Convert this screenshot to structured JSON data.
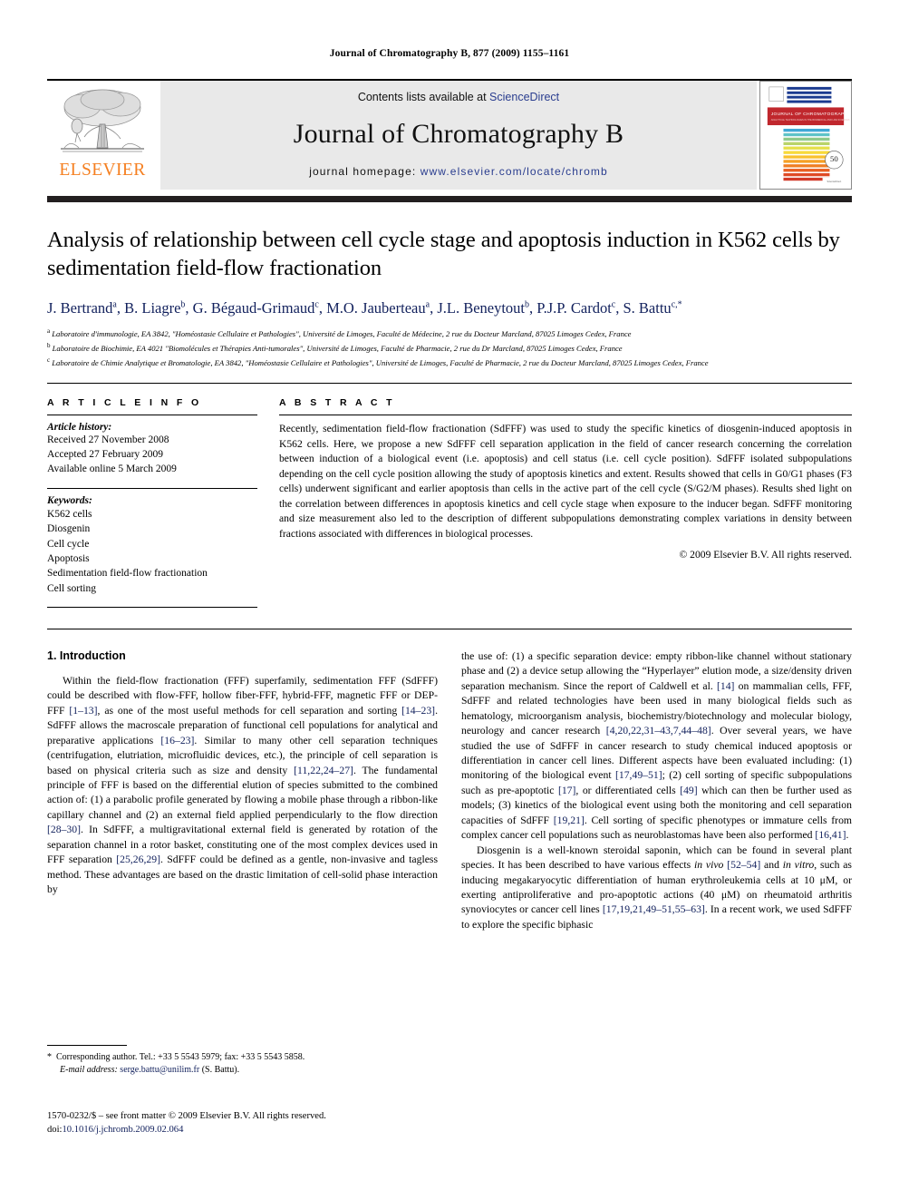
{
  "running_head": "Journal of Chromatography B, 877 (2009) 1155–1161",
  "masthead": {
    "contents_prefix": "Contents lists available at ",
    "sciencedirect": "ScienceDirect",
    "journal_title": "Journal of Chromatography B",
    "homepage_prefix": "journal homepage: ",
    "homepage_url": "www.elsevier.com/locate/chromb",
    "publisher_logo_text": "ELSEVIER",
    "cover_title": "JOURNAL OF CHROMATOGRAPHY B",
    "cover_badge": "50",
    "accent_orange": "#F57F20",
    "accent_link": "#2a3d8f",
    "cover_red": "#c0272d"
  },
  "article": {
    "title": "Analysis of relationship between cell cycle stage and apoptosis induction in K562 cells by sedimentation field-flow fractionation",
    "authors": [
      {
        "name": "J. Bertrand",
        "sup": "a"
      },
      {
        "name": "B. Liagre",
        "sup": "b"
      },
      {
        "name": "G. Bégaud-Grimaud",
        "sup": "c"
      },
      {
        "name": "M.O. Jauberteau",
        "sup": "a"
      },
      {
        "name": "J.L. Beneytout",
        "sup": "b"
      },
      {
        "name": "P.J.P. Cardot",
        "sup": "c"
      },
      {
        "name": "S. Battu",
        "sup": "c,*"
      }
    ],
    "affiliations": [
      {
        "mark": "a",
        "text": "Laboratoire d'immunologie, EA 3842, \"Homéostasie Cellulaire et Pathologies\", Université de Limoges, Faculté de Médecine, 2 rue du Docteur Marcland, 87025 Limoges Cedex, France"
      },
      {
        "mark": "b",
        "text": "Laboratoire de Biochimie, EA 4021 \"Biomolécules et Thérapies Anti-tumorales\", Université de Limoges, Faculté de Pharmacie, 2 rue du Dr Marcland, 87025 Limoges Cedex, France"
      },
      {
        "mark": "c",
        "text": "Laboratoire de Chimie Analytique et Bromatologie, EA 3842, \"Homéostasie Cellulaire et Pathologies\", Université de Limoges, Faculté de Pharmacie, 2 rue du Docteur Marcland, 87025 Limoges Cedex, France"
      }
    ]
  },
  "article_info": {
    "heading": "A R T I C L E    I N F O",
    "history_label": "Article history:",
    "history": [
      "Received 27 November 2008",
      "Accepted 27 February 2009",
      "Available online 5 March 2009"
    ],
    "keywords_label": "Keywords:",
    "keywords": [
      "K562 cells",
      "Diosgenin",
      "Cell cycle",
      "Apoptosis",
      "Sedimentation field-flow fractionation",
      "Cell sorting"
    ]
  },
  "abstract": {
    "heading": "A B S T R A C T",
    "text": "Recently, sedimentation field-flow fractionation (SdFFF) was used to study the specific kinetics of diosgenin-induced apoptosis in K562 cells. Here, we propose a new SdFFF cell separation application in the field of cancer research concerning the correlation between induction of a biological event (i.e. apoptosis) and cell status (i.e. cell cycle position). SdFFF isolated subpopulations depending on the cell cycle position allowing the study of apoptosis kinetics and extent. Results showed that cells in G0/G1 phases (F3 cells) underwent significant and earlier apoptosis than cells in the active part of the cell cycle (S/G2/M phases). Results shed light on the correlation between differences in apoptosis kinetics and cell cycle stage when exposure to the inducer began. SdFFF monitoring and size measurement also led to the description of different subpopulations demonstrating complex variations in density between fractions associated with differences in biological processes.",
    "copyright": "© 2009 Elsevier B.V. All rights reserved."
  },
  "body": {
    "section_title": "1.  Introduction",
    "left_paragraph": "Within the field-flow fractionation (FFF) superfamily, sedimentation FFF (SdFFF) could be described with flow-FFF, hollow fiber-FFF, hybrid-FFF, magnetic FFF or DEP-FFF [1–13], as one of the most useful methods for cell separation and sorting [14–23]. SdFFF allows the macroscale preparation of functional cell populations for analytical and preparative applications [16–23]. Similar to many other cell separation techniques (centrifugation, elutriation, microfluidic devices, etc.), the principle of cell separation is based on physical criteria such as size and density [11,22,24–27]. The fundamental principle of FFF is based on the differential elution of species submitted to the combined action of: (1) a parabolic profile generated by flowing a mobile phase through a ribbon-like capillary channel and (2) an external field applied perpendicularly to the flow direction [28–30]. In SdFFF, a multigravitational external field is generated by rotation of the separation channel in a rotor basket, constituting one of the most complex devices used in FFF separation [25,26,29]. SdFFF could be defined as a gentle, non-invasive and tagless method. These advantages are based on the drastic limitation of cell-solid phase interaction by",
    "right_paragraph_1": "the use of: (1) a specific separation device: empty ribbon-like channel without stationary phase and (2) a device setup allowing the “Hyperlayer” elution mode, a size/density driven separation mechanism. Since the report of Caldwell et al. [14] on mammalian cells, FFF, SdFFF and related technologies have been used in many biological fields such as hematology, microorganism analysis, biochemistry/biotechnology and molecular biology, neurology and cancer research [4,20,22,31–43,7,44–48]. Over several years, we have studied the use of SdFFF in cancer research to study chemical induced apoptosis or differentiation in cancer cell lines. Different aspects have been evaluated including: (1) monitoring of the biological event [17,49–51]; (2) cell sorting of specific subpopulations such as pre-apoptotic [17], or differentiated cells [49] which can then be further used as models; (3) kinetics of the biological event using both the monitoring and cell separation capacities of SdFFF [19,21]. Cell sorting of specific phenotypes or immature cells from complex cancer cell populations such as neuroblastomas have been also performed [16,41].",
    "right_paragraph_2": "Diosgenin is a well-known steroidal saponin, which can be found in several plant species. It has been described to have various effects in vivo [52–54] and in vitro, such as inducing megakaryocytic differentiation of human erythroleukemia cells at 10 μM, or exerting antiproliferative and pro-apoptotic actions (40 μM) on rheumatoid arthritis synoviocytes or cancer cell lines [17,19,21,49–51,55–63]. In a recent work, we used SdFFF to explore the specific biphasic"
  },
  "footnote": {
    "star": "*",
    "corresponding": "Corresponding author. Tel.: +33 5 5543 5979; fax: +33 5 5543 5858.",
    "email_label": "E-mail address:",
    "email": "serge.battu@unilim.fr",
    "email_owner": "(S. Battu)."
  },
  "footer": {
    "issn_line": "1570-0232/$ – see front matter © 2009 Elsevier B.V. All rights reserved.",
    "doi_label": "doi:",
    "doi_value": "10.1016/j.jchromb.2009.02.064"
  }
}
